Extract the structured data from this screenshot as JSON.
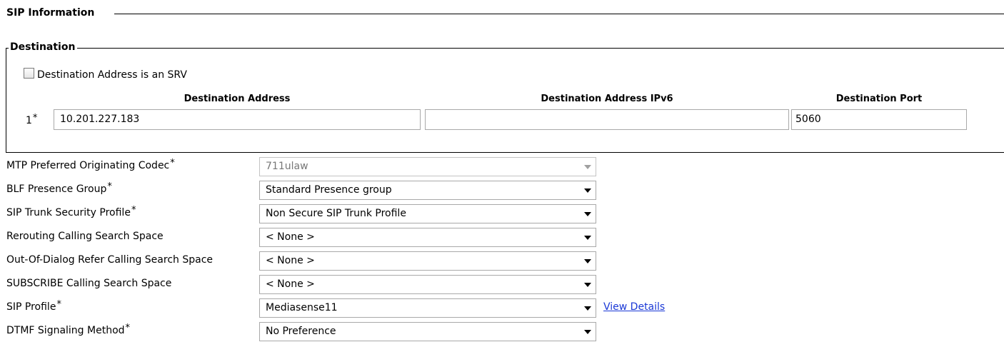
{
  "sip_information": {
    "title": "SIP Information"
  },
  "destination": {
    "title": "Destination",
    "srv_checkbox": {
      "label": "Destination Address is an SRV",
      "checked": false
    },
    "columns": {
      "address": "Destination Address",
      "ipv6": "Destination Address IPv6",
      "port": "Destination Port"
    },
    "rows": [
      {
        "index": "1",
        "required_mark": "*",
        "address": "10.201.227.183",
        "ipv6": "",
        "port": "5060"
      }
    ]
  },
  "fields": [
    {
      "label": "MTP Preferred Originating Codec",
      "required": "*",
      "value": "711ulaw",
      "disabled": true
    },
    {
      "label": "BLF Presence Group",
      "required": "*",
      "value": "Standard Presence group"
    },
    {
      "label": "SIP Trunk Security Profile",
      "required": "*",
      "value": "Non Secure SIP Trunk Profile"
    },
    {
      "label": "Rerouting Calling Search Space",
      "required": "",
      "value": "< None >"
    },
    {
      "label": "Out-Of-Dialog Refer Calling Search Space",
      "required": "",
      "value": "< None >"
    },
    {
      "label": "SUBSCRIBE Calling Search Space",
      "required": "",
      "value": "< None >"
    },
    {
      "label": "SIP Profile",
      "required": "*",
      "value": "Mediasense11",
      "link": "View Details"
    },
    {
      "label": "DTMF Signaling Method",
      "required": "*",
      "value": "No Preference"
    }
  ]
}
